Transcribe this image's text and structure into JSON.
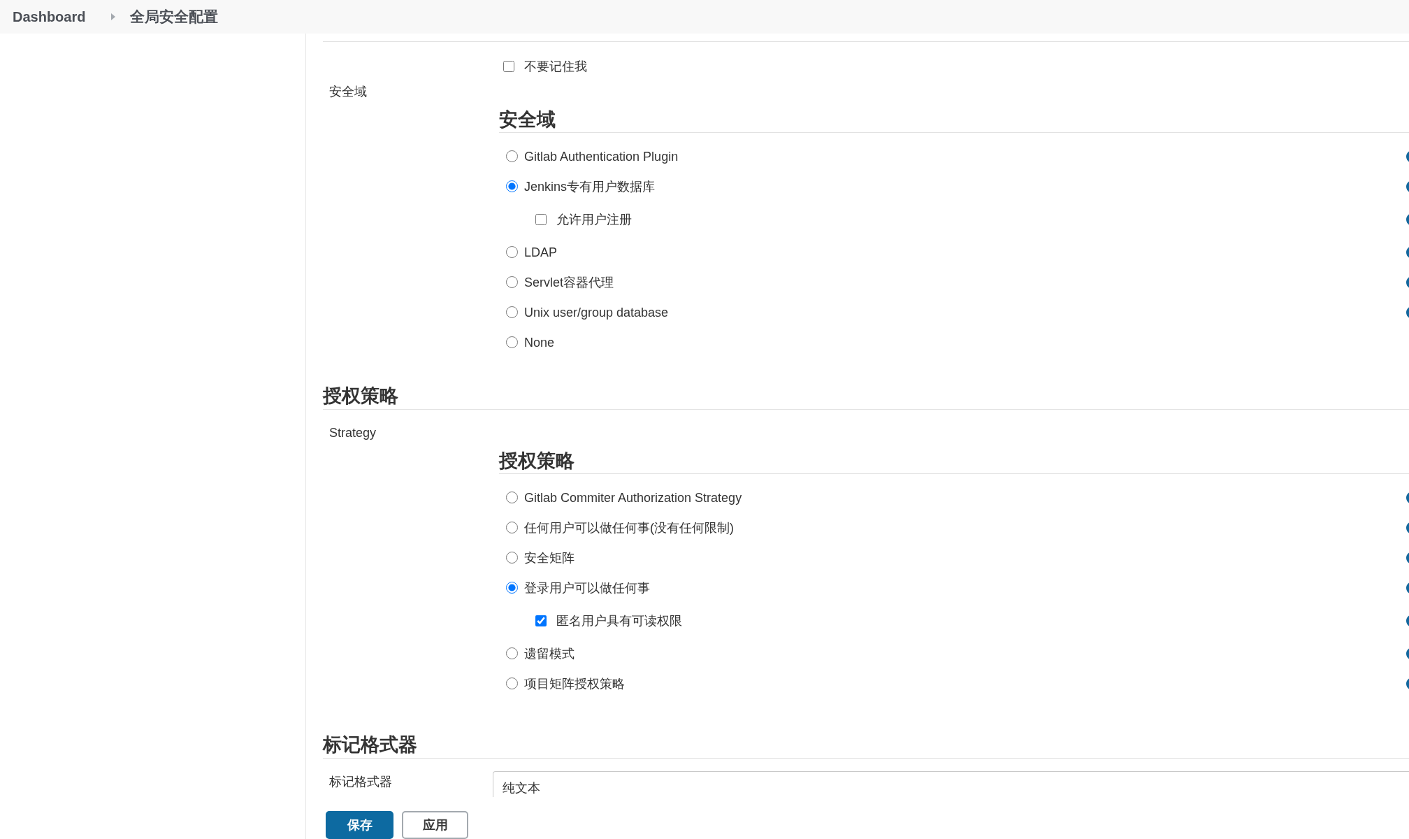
{
  "breadcrumb": [
    {
      "label": "Dashboard"
    },
    {
      "label": "全局安全配置"
    }
  ],
  "authentication": {
    "options": [
      {
        "kind": "checkbox",
        "label": "不要记住我",
        "checked": false,
        "help": false
      }
    ],
    "realm": {
      "label": "安全域",
      "heading": "安全域",
      "options": [
        {
          "kind": "radio",
          "label": "Gitlab Authentication Plugin",
          "selected": false,
          "help": true
        },
        {
          "kind": "radio",
          "label": "Jenkins专有用户数据库",
          "selected": true,
          "help": true,
          "children": [
            {
              "kind": "checkbox",
              "label": "允许用户注册",
              "checked": false,
              "help": true
            }
          ]
        },
        {
          "kind": "radio",
          "label": "LDAP",
          "selected": false,
          "help": true
        },
        {
          "kind": "radio",
          "label": "Servlet容器代理",
          "selected": false,
          "help": true
        },
        {
          "kind": "radio",
          "label": "Unix user/group database",
          "selected": false,
          "help": true
        },
        {
          "kind": "radio",
          "label": "None",
          "selected": false,
          "help": false
        }
      ]
    }
  },
  "authorization": {
    "heading": "授权策略",
    "label": "Strategy",
    "subheading": "授权策略",
    "options": [
      {
        "kind": "radio",
        "label": "Gitlab Commiter Authorization Strategy",
        "selected": false,
        "help": true
      },
      {
        "kind": "radio",
        "label": "任何用户可以做任何事(没有任何限制)",
        "selected": false,
        "help": true
      },
      {
        "kind": "radio",
        "label": "安全矩阵",
        "selected": false,
        "help": true
      },
      {
        "kind": "radio",
        "label": "登录用户可以做任何事",
        "selected": true,
        "help": true,
        "children": [
          {
            "kind": "checkbox",
            "label": "匿名用户具有可读权限",
            "checked": true,
            "help": true
          }
        ]
      },
      {
        "kind": "radio",
        "label": "遗留模式",
        "selected": false,
        "help": true
      },
      {
        "kind": "radio",
        "label": "项目矩阵授权策略",
        "selected": false,
        "help": true
      }
    ]
  },
  "markup_formatter": {
    "heading": "标记格式器",
    "label": "标记格式器",
    "value": "纯文本"
  },
  "buttons": [
    {
      "kind": "primary",
      "label": "保存"
    },
    {
      "kind": "secondary",
      "label": "应用"
    }
  ]
}
